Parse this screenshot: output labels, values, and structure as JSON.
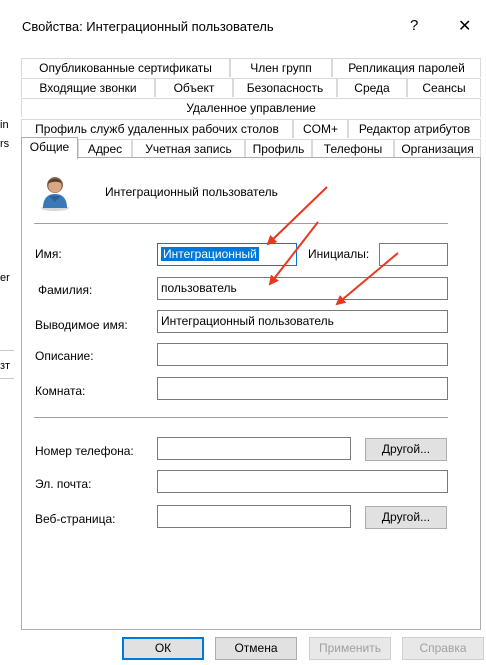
{
  "background_window": {
    "fragments": [
      "in",
      "rs",
      "er",
      "зт"
    ]
  },
  "dialog": {
    "title": "Свойства: Интеграционный пользователь",
    "help_glyph": "?",
    "close_glyph": "✕"
  },
  "tabs": {
    "row1": [
      "Опубликованные сертификаты",
      "Член групп",
      "Репликация паролей"
    ],
    "row2": [
      "Входящие звонки",
      "Объект",
      "Безопасность",
      "Среда",
      "Сеансы"
    ],
    "row3": [
      "Удаленное управление"
    ],
    "row4": [
      "Профиль служб удаленных рабочих столов",
      "COM+",
      "Редактор атрибутов"
    ],
    "row5": [
      "Общие",
      "Адрес",
      "Учетная запись",
      "Профиль",
      "Телефоны",
      "Организация"
    ],
    "active": "Общие"
  },
  "general": {
    "display_header": "Интеграционный пользователь",
    "first_name_label": "Имя:",
    "first_name_value": "Интеграционный",
    "initials_label": "Инициалы:",
    "initials_value": "",
    "last_name_label": "Фамилия:",
    "last_name_value": "пользователь",
    "display_name_label": "Выводимое имя:",
    "display_name_value": "Интеграционный пользователь",
    "description_label": "Описание:",
    "description_value": "",
    "office_label": "Комната:",
    "office_value": "",
    "phone_label": "Номер телефона:",
    "phone_value": "",
    "phone_other_button": "Другой...",
    "email_label": "Эл. почта:",
    "email_value": "",
    "webpage_label": "Веб-страница:",
    "webpage_value": "",
    "webpage_other_button": "Другой..."
  },
  "footer": {
    "ok": "ОК",
    "cancel": "Отмена",
    "apply": "Применить",
    "help": "Справка"
  },
  "colors": {
    "accent": "#0078d7",
    "annotation_arrow": "#e8381f"
  }
}
